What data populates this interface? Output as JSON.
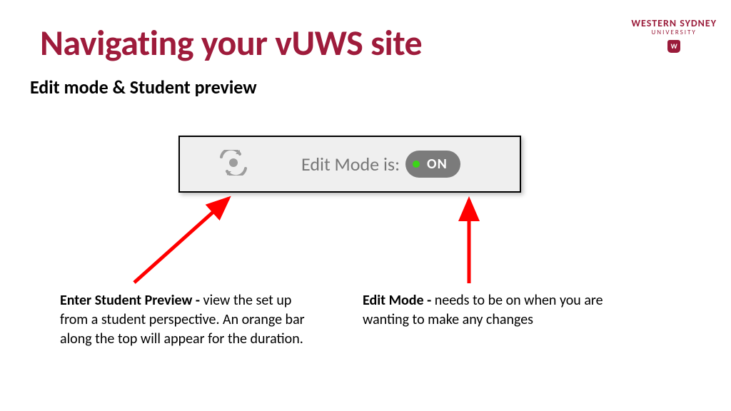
{
  "logo": {
    "top": "WESTERN SYDNEY",
    "sub": "UNIVERSITY",
    "shield_letter": "W"
  },
  "title": "Navigating your vUWS site",
  "subtitle": "Edit mode & Student preview",
  "toolbar": {
    "edit_mode_label": "Edit Mode is:",
    "toggle_text": "ON"
  },
  "captions": {
    "left": {
      "lead": "Enter Student Preview - ",
      "body": " view the set up from a student perspective. An orange bar along the top will appear for the duration."
    },
    "right": {
      "lead": "Edit Mode - ",
      "body": " needs to be on when you are wanting to make any changes"
    }
  },
  "colors": {
    "brand": "#9e1b3b",
    "arrow": "#ff0000"
  }
}
